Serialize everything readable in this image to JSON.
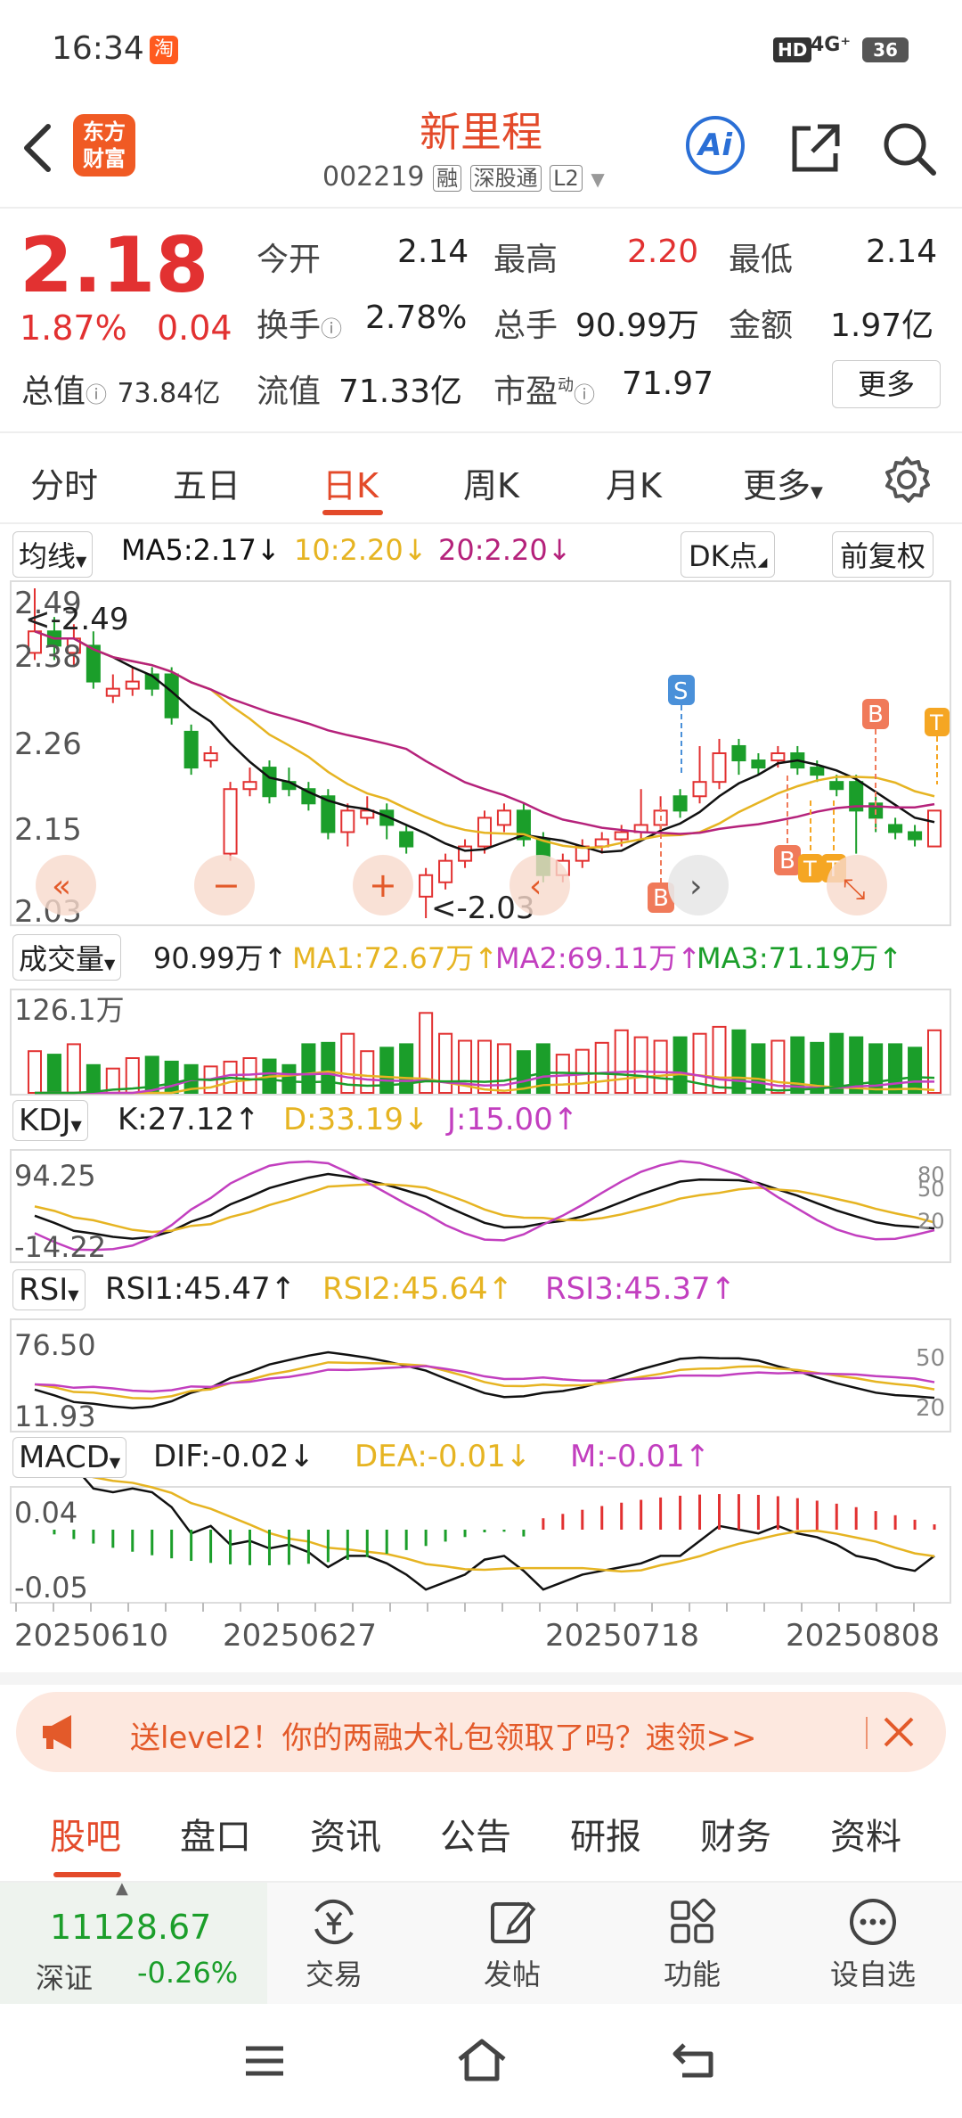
{
  "status_bar": {
    "time": "16:34",
    "app_badge": "淘",
    "hd": "HD",
    "network": "4G⁺",
    "battery": "36"
  },
  "header": {
    "title": "新里程",
    "code": "002219",
    "tags": [
      "融",
      "深股通",
      "L2"
    ],
    "logo_line1": "东方",
    "logo_line2": "财富",
    "ai_label": "Ai"
  },
  "quote": {
    "price": "2.18",
    "change_pct": "1.87%",
    "change": "0.04",
    "market_cap_label": "总值",
    "market_cap": "73.84亿",
    "open_label": "今开",
    "open": "2.14",
    "high_label": "最高",
    "high": "2.20",
    "low_label": "最低",
    "low": "2.14",
    "turnover_label": "换手",
    "turnover": "2.78%",
    "volume_label": "总手",
    "volume": "90.99万",
    "amount_label": "金额",
    "amount": "1.97亿",
    "float_cap_label": "流值",
    "float_cap": "71.33亿",
    "pe_label": "市盈",
    "pe_sup": "动",
    "pe": "71.97",
    "more_label": "更多"
  },
  "period_tabs": [
    "分时",
    "五日",
    "日K",
    "周K",
    "月K",
    "更多"
  ],
  "active_tab": 2,
  "ma_bar": {
    "select": "均线",
    "ma5": "MA5:2.17↓",
    "ma10": "10:2.20↓",
    "ma20": "20:2.20↓",
    "dk": "DK点",
    "adjust": "前复权"
  },
  "colors": {
    "red": "#e23131",
    "green": "#1b9e2a",
    "ma10": "#e6b422",
    "ma20": "#b5227b",
    "ma5": "#111111",
    "signal_b": "#f07a5a",
    "signal_s": "#4a90d9",
    "signal_t": "#f5a623"
  },
  "kline": {
    "y_ticks": [
      "2.49",
      "2.38",
      "2.26",
      "2.15",
      "2.03"
    ],
    "max_label": "<-2.49",
    "min_label": "<-2.03",
    "signals": [
      "S",
      "B",
      "B",
      "T",
      "T",
      "B",
      "T"
    ]
  },
  "volume_panel": {
    "select": "成交量",
    "value": "90.99万↑",
    "ma1": "MA1:72.67万↑",
    "ma2": "MA2:69.11万↑",
    "ma3": "MA3:71.19万↑",
    "top_label": "126.1万"
  },
  "kdj_panel": {
    "select": "KDJ",
    "k": "K:27.12↑",
    "d": "D:33.19↓",
    "j": "J:15.00↑",
    "top": "94.25",
    "bottom": "-14.22",
    "right_ticks": [
      "80",
      "50",
      "20"
    ]
  },
  "rsi_panel": {
    "select": "RSI",
    "rsi1": "RSI1:45.47↑",
    "rsi2": "RSI2:45.64↑",
    "rsi3": "RSI3:45.37↑",
    "top": "76.50",
    "bottom": "11.93",
    "right_ticks": [
      "50",
      "20"
    ]
  },
  "macd_panel": {
    "select": "MACD",
    "dif": "DIF:-0.02↓",
    "dea": "DEA:-0.01↓",
    "m": "M:-0.01↑",
    "top": "0.04",
    "bottom": "-0.05"
  },
  "dates": [
    "20250610",
    "20250627",
    "20250718",
    "20250808"
  ],
  "banner": {
    "text": "送level2！你的两融大礼包领取了吗？速领>>"
  },
  "bottom_tabs": [
    "股吧",
    "盘口",
    "资讯",
    "公告",
    "研报",
    "财务",
    "资料"
  ],
  "bottom_active": 0,
  "index": {
    "value": "11128.67",
    "name": "深证",
    "change": "-0.26%"
  },
  "actions": [
    "交易",
    "发帖",
    "功能",
    "设自选"
  ]
}
